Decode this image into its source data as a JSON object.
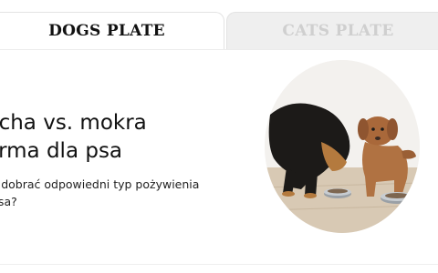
{
  "tabs": [
    {
      "label": "DOGS PLATE",
      "active": true
    },
    {
      "label": "CATS PLATE",
      "active": false
    }
  ],
  "article": {
    "title_line1": "ucha vs. mokra",
    "title_line2": "arma dla psa",
    "subtitle_line1": "k dobrać odpowiedni typ pożywienia",
    "subtitle_line2": "psa?"
  },
  "colors": {
    "active_tab_bg": "#ffffff",
    "inactive_tab_bg": "#efefef",
    "inactive_tab_text": "#cfcfcf",
    "text": "#111111"
  }
}
